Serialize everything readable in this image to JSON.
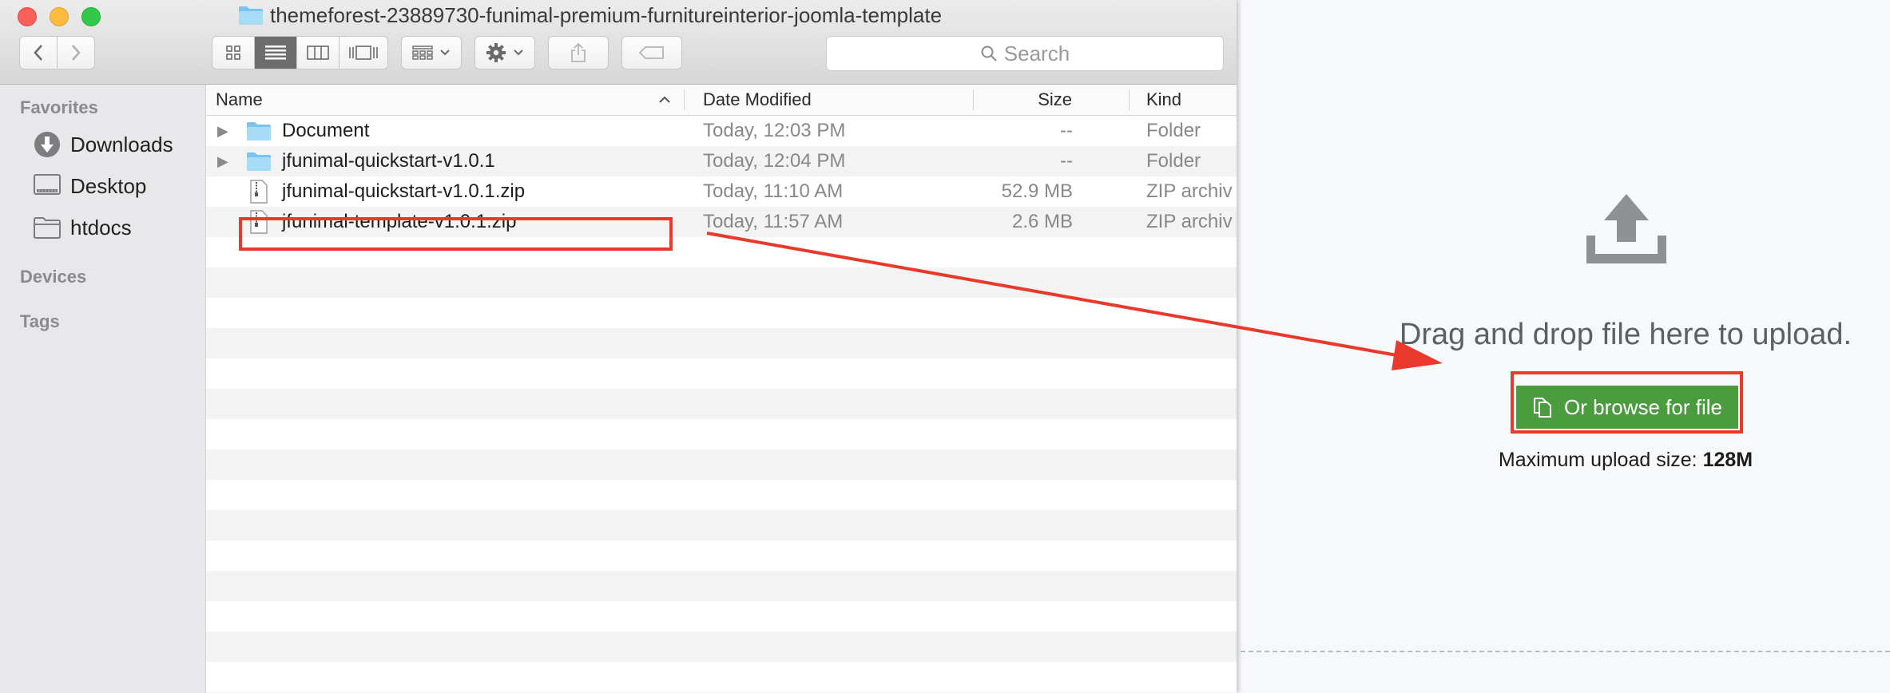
{
  "window": {
    "title": "themeforest-23889730-funimal-premium-furnitureinterior-joomla-template"
  },
  "toolbar": {
    "search_placeholder": "Search"
  },
  "sidebar": {
    "favorites_heading": "Favorites",
    "items": [
      {
        "label": "Downloads",
        "icon": "downloads-icon"
      },
      {
        "label": "Desktop",
        "icon": "desktop-icon"
      },
      {
        "label": "htdocs",
        "icon": "folder-icon"
      }
    ],
    "devices_heading": "Devices",
    "tags_heading": "Tags"
  },
  "columns": {
    "name": "Name",
    "date": "Date Modified",
    "size": "Size",
    "kind": "Kind"
  },
  "files": [
    {
      "name": "Document",
      "date": "Today, 12:03 PM",
      "size": "--",
      "kind": "Folder",
      "disclosure": "▶"
    },
    {
      "name": "jfunimal-quickstart-v1.0.1",
      "date": "Today, 12:04 PM",
      "size": "--",
      "kind": "Folder",
      "disclosure": "▶"
    },
    {
      "name": "jfunimal-quickstart-v1.0.1.zip",
      "date": "Today, 11:10 AM",
      "size": "52.9 MB",
      "kind": "ZIP archiv"
    },
    {
      "name": "jfunimal-template-v1.0.1.zip",
      "date": "Today, 11:57 AM",
      "size": "2.6 MB",
      "kind": "ZIP archiv"
    }
  ],
  "upload": {
    "drop_text": "Drag and drop file here to upload.",
    "browse_label": "Or browse for file",
    "max_label": "Maximum upload size:",
    "max_value": "128M"
  },
  "colors": {
    "annotation_red": "#e8392c",
    "browse_green": "#4a9c3f"
  }
}
